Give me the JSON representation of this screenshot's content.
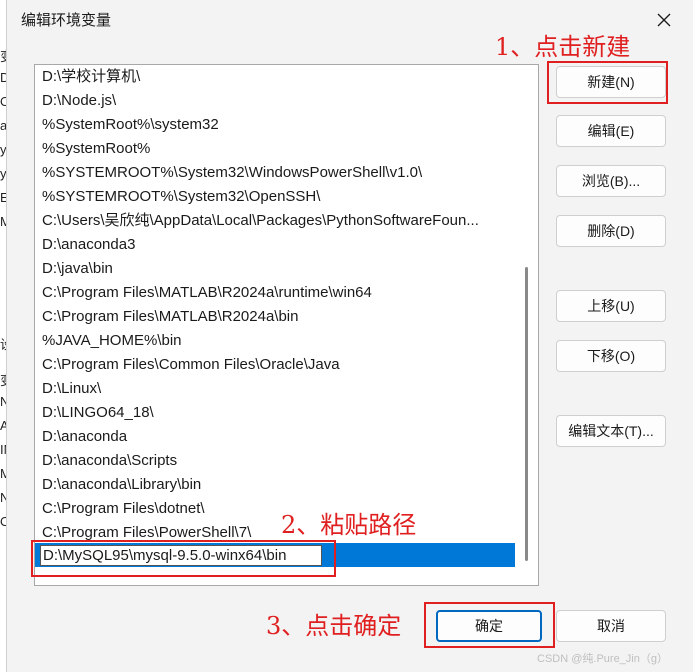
{
  "dialog": {
    "title": "编辑环境变量",
    "close_icon": "close-icon"
  },
  "background_fragments": [
    "变",
    "DL",
    "Or",
    "a",
    "y",
    "y",
    "E",
    "M",
    "设",
    "变",
    "N",
    "A",
    "IN",
    "MI",
    "NU",
    "OS"
  ],
  "path_list": {
    "items": [
      "D:\\学校计算机\\",
      "D:\\Node.js\\",
      "%SystemRoot%\\system32",
      "%SystemRoot%",
      "%SYSTEMROOT%\\System32\\WindowsPowerShell\\v1.0\\",
      "%SYSTEMROOT%\\System32\\OpenSSH\\",
      "C:\\Users\\吴欣纯\\AppData\\Local\\Packages\\PythonSoftwareFoun...",
      "D:\\anaconda3",
      "D:\\java\\bin",
      "C:\\Program Files\\MATLAB\\R2024a\\runtime\\win64",
      "C:\\Program Files\\MATLAB\\R2024a\\bin",
      "%JAVA_HOME%\\bin",
      "C:\\Program Files\\Common Files\\Oracle\\Java",
      "D:\\Linux\\",
      "D:\\LINGO64_18\\",
      "D:\\anaconda",
      "D:\\anaconda\\Scripts",
      "D:\\anaconda\\Library\\bin",
      "C:\\Program Files\\dotnet\\",
      "C:\\Program Files\\PowerShell\\7\\"
    ],
    "editing_value": "D:\\MySQL95\\mysql-9.5.0-winx64\\bin"
  },
  "buttons": {
    "new": "新建(N)",
    "edit": "编辑(E)",
    "browse": "浏览(B)...",
    "delete": "删除(D)",
    "move_up": "上移(U)",
    "move_down": "下移(O)",
    "edit_text": "编辑文本(T)...",
    "ok": "确定",
    "cancel": "取消"
  },
  "annotations": {
    "step1": "1、点击新建",
    "step2": "2、粘贴路径",
    "step3": "3、点击确定"
  },
  "watermark": "CSDN @纯.Pure_Jin（g）",
  "colors": {
    "selection": "#0078d7",
    "annotation_red": "#e02020",
    "primary_border": "#0067c0"
  }
}
